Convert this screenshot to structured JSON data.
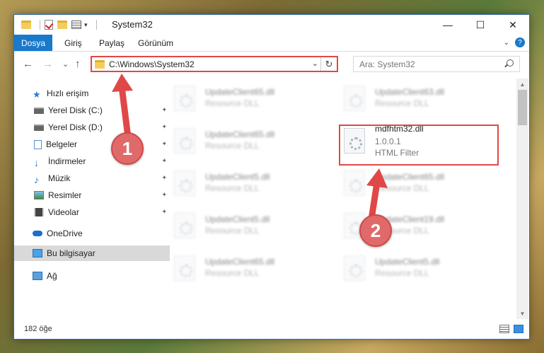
{
  "window": {
    "title": "System32",
    "controls": {
      "minimize": "—",
      "maximize": "☐",
      "close": "✕"
    }
  },
  "ribbon": {
    "file_tab": "Dosya",
    "tabs": [
      "Giriş",
      "Paylaş",
      "Görünüm"
    ],
    "expand_glyph": "⌄",
    "help_glyph": "?"
  },
  "nav": {
    "back": "←",
    "forward": "→",
    "recent": "⌄",
    "up": "↑",
    "address": "C:\\Windows\\System32",
    "address_chevron": "⌄",
    "refresh": "↻",
    "search_placeholder": "Ara: System32"
  },
  "sidebar": {
    "items": [
      {
        "label": "Hızlı erişim",
        "icon": "star-icon",
        "pinned": false
      },
      {
        "label": "Yerel Disk (C:)",
        "icon": "drive-icon",
        "pinned": true
      },
      {
        "label": "Yerel Disk (D:)",
        "icon": "drive-icon",
        "pinned": true
      },
      {
        "label": "Belgeler",
        "icon": "documents-icon",
        "pinned": true
      },
      {
        "label": "İndirmeler",
        "icon": "download-icon",
        "pinned": true
      },
      {
        "label": "Müzik",
        "icon": "music-icon",
        "pinned": true
      },
      {
        "label": "Resimler",
        "icon": "pictures-icon",
        "pinned": true
      },
      {
        "label": "Videolar",
        "icon": "videos-icon",
        "pinned": true
      },
      {
        "label": "OneDrive",
        "icon": "cloud-icon",
        "pinned": false
      },
      {
        "label": "Bu bilgisayar",
        "icon": "computer-icon",
        "pinned": false,
        "selected": true
      },
      {
        "label": "Ağ",
        "icon": "network-icon",
        "pinned": false
      }
    ],
    "pin_glyph": "📌"
  },
  "files": [
    {
      "name": "UpdateClient65.dll",
      "desc": "Resource DLL"
    },
    {
      "name": "UpdateClient63.dll",
      "desc": "Resource DLL"
    },
    {
      "name": "UpdateClient65.dll",
      "desc": "Resource DLL"
    },
    {
      "name": "mdfhtm32.dll",
      "version": "1.0.0.1",
      "desc": "HTML Filter",
      "highlighted": true
    },
    {
      "name": "UpdateClient5.dll",
      "desc": "Resource DLL"
    },
    {
      "name": "UpdateClient65.dll",
      "desc": "Resource DLL"
    },
    {
      "name": "UpdateClient5.dll",
      "desc": "Resource DLL"
    },
    {
      "name": "UpdateClient19.dll",
      "desc": "Resource DLL"
    },
    {
      "name": "UpdateClient65.dll",
      "desc": "Resource DLL"
    },
    {
      "name": "UpdateClient5.dll",
      "desc": "Resource DLL"
    }
  ],
  "status": {
    "count": "182 öğe"
  },
  "scroll": {
    "up": "▲",
    "down": "▼"
  },
  "annotations": {
    "step1": "1",
    "step2": "2",
    "color": "#e04848"
  }
}
